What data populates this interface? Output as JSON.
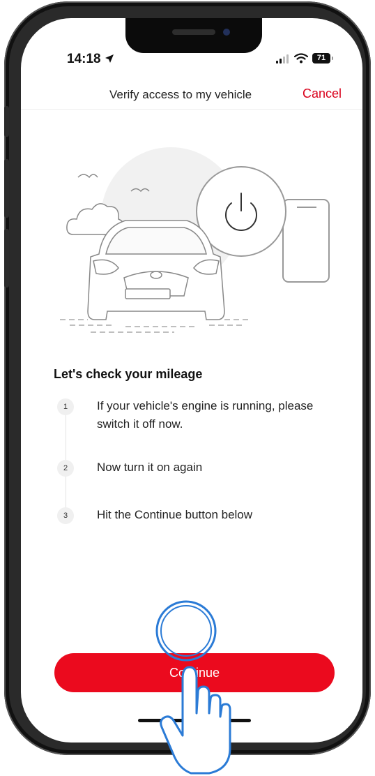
{
  "status_bar": {
    "time": "14:18",
    "battery": "71"
  },
  "header": {
    "title": "Verify access to my vehicle",
    "cancel_label": "Cancel"
  },
  "illustration": {
    "icon": "car-illustration",
    "power_icon": "power-icon"
  },
  "main": {
    "heading": "Let's check your mileage",
    "steps": [
      {
        "number": "1",
        "text": "If your vehicle's engine is running, please switch it off now."
      },
      {
        "number": "2",
        "text": "Now turn it on again"
      },
      {
        "number": "3",
        "text": "Hit the Continue button below"
      }
    ]
  },
  "footer": {
    "continue_label": "Continue"
  },
  "colors": {
    "accent": "#eb0a1e",
    "cancel_text": "#d9001b",
    "hint_overlay": "#2b7bd6"
  }
}
